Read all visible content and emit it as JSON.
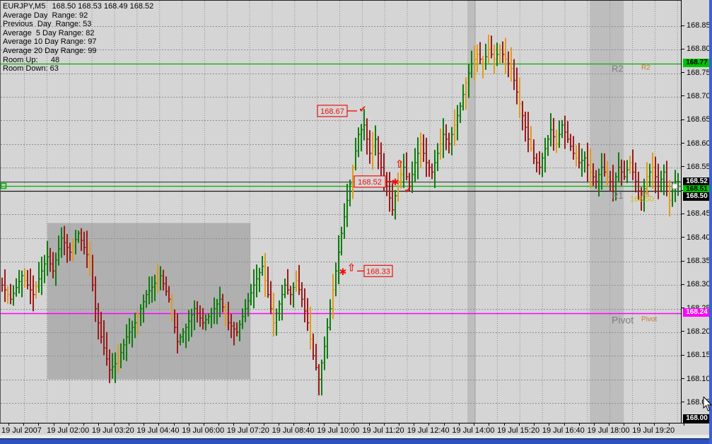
{
  "chart": {
    "symbol_line": "EURJPY,M5   168.50 168.53 168.49 168.52",
    "info_lines": [
      "Average Day  Range: 92",
      "Previous  Day  Range: 53",
      "Average  5 Day Range: 82",
      "Average 10 Day Range: 97",
      "Average 20 Day Range: 99",
      "Room Up:      48",
      "Room Down: 63"
    ],
    "colors": {
      "background": "#d5d5d5",
      "region_gray": "#b0b0b0",
      "band_gray": "#bdbdbd",
      "grid": "#8f8f8f",
      "bar_up": "#0f7d0f",
      "bar_down": "#9b1c1c",
      "bar_neutral": "#e39b1b",
      "ask_green": "#00b400",
      "pivot_magenta": "#ff00ff",
      "level_black": "#1a1a1a",
      "annotation_red": "#ee1111",
      "label_gray": "#7d7d7d",
      "label_orange": "#c87832",
      "label_yellow": "#d4b81e",
      "badge_green": "#00c400",
      "badge_black": "#000000",
      "badge_magenta": "#ff00ff",
      "bottom_bar_blue": "#2b52c4"
    }
  },
  "chart_data": {
    "type": "bar",
    "symbol": "EURJPY",
    "timeframe": "M5",
    "title": "EURJPY,M5",
    "ohlc_display": {
      "open": "168.50",
      "high": "168.53",
      "low": "168.49",
      "close": "168.52"
    },
    "y_axis_ticks": [
      "168.85",
      "168.80",
      "168.75",
      "168.70",
      "168.65",
      "168.60",
      "168.55",
      "168.50",
      "168.45",
      "168.40",
      "168.35",
      "168.30",
      "168.25",
      "168.20",
      "168.15",
      "168.10",
      "168.05"
    ],
    "y_range": [
      168.0,
      168.88
    ],
    "x_labels": [
      "19 Jul 2007",
      "19 Jul 02:00",
      "19 Jul 03:20",
      "19 Jul 04:40",
      "19 Jul 06:00",
      "19 Jul 07:20",
      "19 Jul 08:40",
      "19 Jul 10:00",
      "19 Jul 11:20",
      "19 Jul 12:40",
      "19 Jul 14:00",
      "19 Jul 15:20",
      "19 Jul 16:40",
      "19 Jul 18:00",
      "19 Jul 19:20"
    ],
    "grid": "dashed",
    "levels": [
      {
        "name": "R2",
        "price": 168.77,
        "style": "green",
        "gray_label": "R2",
        "orange_label": "R2",
        "value_label": ""
      },
      {
        "name": "bid",
        "price": 168.52,
        "style": "dark",
        "gray_label": "",
        "orange_label": "",
        "value_label": ""
      },
      {
        "name": "ask",
        "price": 168.51,
        "style": "green",
        "gray_label": "",
        "orange_label": "",
        "value_label": ""
      },
      {
        "name": "R1",
        "price": 168.5,
        "style": "black",
        "gray_label": "R1",
        "orange_label": "R1",
        "value_label": "168.50"
      },
      {
        "name": "Pivot",
        "price": 168.24,
        "style": "magenta",
        "gray_label": "Pivot",
        "orange_label": "Pivot",
        "value_label": ""
      }
    ],
    "badges": [
      {
        "text": "168.77",
        "price": 168.77,
        "bg": "green"
      },
      {
        "text": "168.52",
        "price": 168.518,
        "bg": "black"
      },
      {
        "text": "168.51",
        "price": 168.502,
        "bg": "green"
      },
      {
        "text": "168.50",
        "price": 168.487,
        "bg": "black"
      },
      {
        "text": "168.24",
        "price": 168.24,
        "bg": "magenta"
      },
      {
        "text": "168.00",
        "price": 168.003,
        "bg": "black"
      }
    ],
    "annotations": [
      {
        "label": "168.67",
        "price": 168.67,
        "box_from_bar": 111.5,
        "box_to_bar": 122,
        "line_to_bar": 125.5,
        "dir": "right",
        "marks": [
          {
            "glyph": "check",
            "bar": 127.5,
            "price": 168.675
          }
        ]
      },
      {
        "label": "168.52",
        "price": 168.52,
        "box_from_bar": 124.5,
        "box_to_bar": 135.5,
        "line_to_bar": 139,
        "dir": "right",
        "marks": [
          {
            "glyph": "star",
            "bar": 139,
            "price": 168.52
          },
          {
            "glyph": "arrow-up",
            "bar": 140.5,
            "price": 168.557
          },
          {
            "glyph": "check",
            "bar": 143.5,
            "price": 168.503
          }
        ]
      },
      {
        "label": "168.33",
        "price": 168.33,
        "box_from_bar": 128,
        "box_to_bar": 138,
        "line_to_bar": 125.5,
        "dir": "left",
        "marks": [
          {
            "glyph": "arrow-up",
            "bar": 123.5,
            "price": 168.337
          },
          {
            "glyph": "star",
            "bar": 120.5,
            "price": 168.329
          }
        ]
      }
    ],
    "regions": [
      {
        "kind": "rect",
        "from_bar": 16,
        "to_bar": 87.8,
        "top_price": 168.432,
        "bottom_price": 168.1
      },
      {
        "kind": "vband",
        "from_bar": 164.5,
        "to_bar": 167.5
      },
      {
        "kind": "vband",
        "from_bar": 207.8,
        "to_bar": 219.8
      }
    ],
    "price_path": [
      [
        0,
        168.31
      ],
      [
        4,
        168.27
      ],
      [
        8,
        168.32
      ],
      [
        12,
        168.28
      ],
      [
        15,
        168.33
      ],
      [
        17,
        168.36
      ],
      [
        19,
        168.33
      ],
      [
        22,
        168.4
      ],
      [
        25,
        168.37
      ],
      [
        28,
        168.41
      ],
      [
        30,
        168.38
      ],
      [
        32,
        168.35
      ],
      [
        34,
        168.25
      ],
      [
        36,
        168.19
      ],
      [
        39,
        168.12
      ],
      [
        42,
        168.14
      ],
      [
        45,
        168.19
      ],
      [
        48,
        168.22
      ],
      [
        52,
        168.28
      ],
      [
        57,
        168.32
      ],
      [
        60,
        168.27
      ],
      [
        63,
        168.18
      ],
      [
        66,
        168.21
      ],
      [
        69,
        168.25
      ],
      [
        72,
        168.22
      ],
      [
        75,
        168.24
      ],
      [
        78,
        168.27
      ],
      [
        81,
        168.22
      ],
      [
        84,
        168.2
      ],
      [
        87,
        168.25
      ],
      [
        90,
        168.3
      ],
      [
        93,
        168.34
      ],
      [
        95,
        168.28
      ],
      [
        97,
        168.22
      ],
      [
        99,
        168.26
      ],
      [
        101,
        168.3
      ],
      [
        103,
        168.28
      ],
      [
        105,
        168.31
      ],
      [
        107,
        168.27
      ],
      [
        109,
        168.22
      ],
      [
        111,
        168.15
      ],
      [
        113,
        168.1
      ],
      [
        115,
        168.17
      ],
      [
        117,
        168.25
      ],
      [
        119,
        168.33
      ],
      [
        121,
        168.41
      ],
      [
        123,
        168.48
      ],
      [
        125,
        168.55
      ],
      [
        127,
        168.62
      ],
      [
        129,
        168.64
      ],
      [
        131,
        168.58
      ],
      [
        133,
        168.61
      ],
      [
        135,
        168.55
      ],
      [
        137,
        168.51
      ],
      [
        139,
        168.46
      ],
      [
        141,
        168.52
      ],
      [
        143,
        168.55
      ],
      [
        145,
        168.51
      ],
      [
        147,
        168.56
      ],
      [
        149,
        168.6
      ],
      [
        151,
        168.56
      ],
      [
        153,
        168.54
      ],
      [
        155,
        168.58
      ],
      [
        157,
        168.62
      ],
      [
        159,
        168.6
      ],
      [
        161,
        168.64
      ],
      [
        163,
        168.68
      ],
      [
        165,
        168.73
      ],
      [
        167,
        168.77
      ],
      [
        169,
        168.79
      ],
      [
        171,
        168.77
      ],
      [
        173,
        168.8
      ],
      [
        175,
        168.78
      ],
      [
        177,
        168.8
      ],
      [
        179,
        168.78
      ],
      [
        181,
        168.76
      ],
      [
        183,
        168.71
      ],
      [
        185,
        168.66
      ],
      [
        187,
        168.61
      ],
      [
        189,
        168.57
      ],
      [
        191,
        168.55
      ],
      [
        193,
        168.59
      ],
      [
        195,
        168.63
      ],
      [
        197,
        168.6
      ],
      [
        199,
        168.64
      ],
      [
        201,
        168.61
      ],
      [
        203,
        168.58
      ],
      [
        205,
        168.56
      ],
      [
        207,
        168.57
      ],
      [
        209,
        168.54
      ],
      [
        211,
        168.52
      ],
      [
        213,
        168.55
      ],
      [
        215,
        168.53
      ],
      [
        217,
        168.51
      ],
      [
        219,
        168.55
      ],
      [
        221,
        168.53
      ],
      [
        223,
        168.56
      ],
      [
        225,
        168.52
      ],
      [
        227,
        168.48
      ],
      [
        229,
        168.53
      ],
      [
        231,
        168.55
      ],
      [
        233,
        168.51
      ],
      [
        235,
        168.54
      ],
      [
        237,
        168.48
      ],
      [
        239,
        168.52
      ]
    ],
    "orange_bars": [
      2,
      8,
      12,
      25,
      31,
      41,
      48,
      55,
      60,
      79,
      93,
      96,
      104,
      109,
      117,
      124,
      131,
      140,
      141,
      148,
      155,
      160,
      164,
      167,
      168,
      170,
      172,
      174,
      176,
      178,
      180,
      183,
      187,
      196,
      203,
      208,
      214,
      222,
      228,
      230,
      236
    ]
  }
}
